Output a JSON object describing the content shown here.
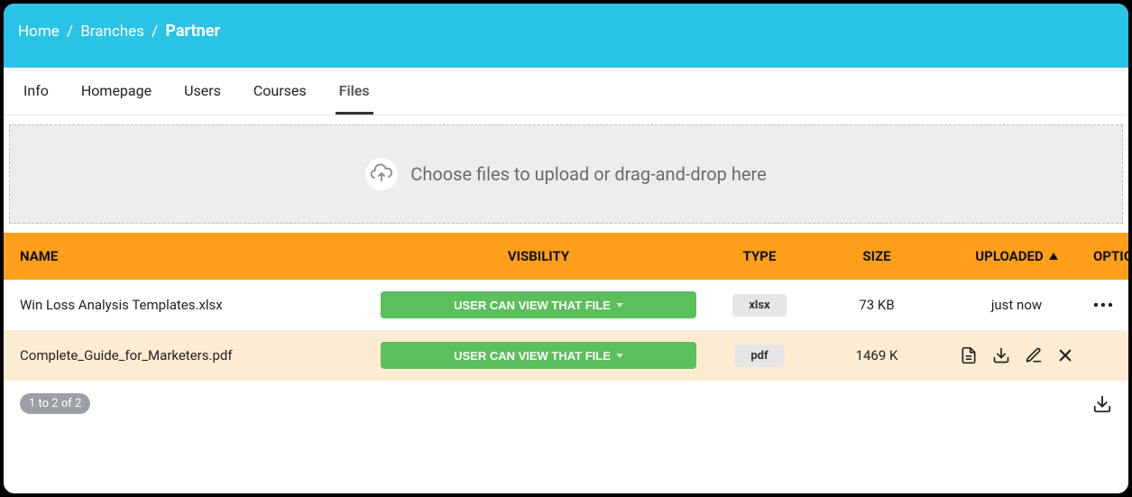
{
  "breadcrumb": {
    "home": "Home",
    "branches": "Branches",
    "current": "Partner",
    "sep": "/"
  },
  "tabs": {
    "items": [
      {
        "label": "Info"
      },
      {
        "label": "Homepage"
      },
      {
        "label": "Users"
      },
      {
        "label": "Courses"
      },
      {
        "label": "Files"
      }
    ]
  },
  "upload": {
    "text": "Choose files to upload or drag-and-drop here"
  },
  "table": {
    "headers": {
      "name": "NAME",
      "visibility": "VISBILITY",
      "type": "TYPE",
      "size": "SIZE",
      "uploaded": "UPLOADED",
      "options": "OPTIONS"
    },
    "rows": [
      {
        "name": "Win Loss Analysis Templates.xlsx",
        "visibility": "USER CAN VIEW THAT FILE",
        "type": "xlsx",
        "size": "73 KB",
        "uploaded": "just now"
      },
      {
        "name": "Complete_Guide_for_Marketers.pdf",
        "visibility": "USER CAN VIEW THAT FILE",
        "type": "pdf",
        "size": "1469 K",
        "uploaded": ""
      }
    ]
  },
  "footer": {
    "pager": "1 to 2 of 2"
  }
}
